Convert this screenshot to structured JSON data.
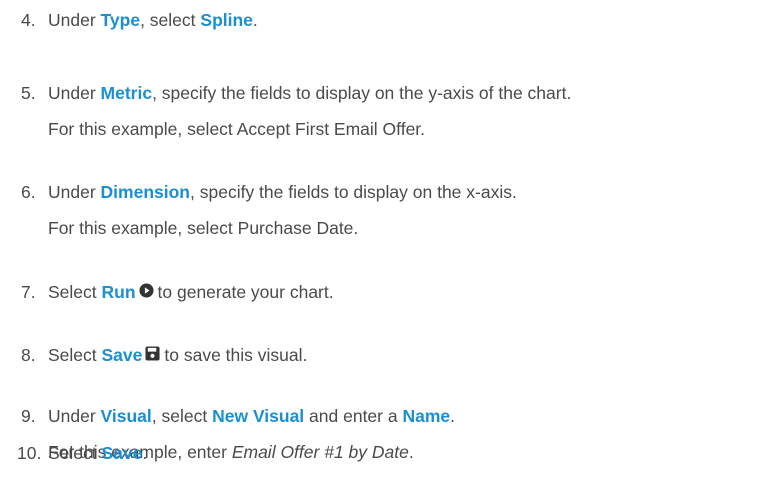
{
  "steps": [
    {
      "number": "4.",
      "segments": [
        {
          "text": "Under "
        },
        {
          "text": "Type",
          "kw": true
        },
        {
          "text": ", select "
        },
        {
          "text": "Spline",
          "kw": true
        },
        {
          "text": "."
        }
      ]
    },
    {
      "number": "5.",
      "segments": [
        {
          "text": "Under "
        },
        {
          "text": "Metric",
          "kw": true
        },
        {
          "text": ", specify the fields to display on the y-axis of the chart."
        }
      ],
      "line2": [
        {
          "text": "For this example, select Accept First Email Offer."
        }
      ]
    },
    {
      "number": "6.",
      "segments": [
        {
          "text": "Under "
        },
        {
          "text": "Dimension",
          "kw": true
        },
        {
          "text": ", specify the fields to display on the x-axis."
        }
      ],
      "line2": [
        {
          "text": "For this example, select Purchase Date."
        }
      ]
    },
    {
      "number": "7.",
      "segments": [
        {
          "text": "Select "
        },
        {
          "text": "Run",
          "kw": true
        },
        {
          "icon": "play-circle-icon"
        },
        {
          "text": "to generate your chart."
        }
      ]
    },
    {
      "number": "8.",
      "segments": [
        {
          "text": "Select "
        },
        {
          "text": "Save",
          "kw": true
        },
        {
          "icon": "floppy-disk-icon"
        },
        {
          "text": "to save this visual."
        }
      ]
    },
    {
      "number": "9.",
      "segments": [
        {
          "text": "Under "
        },
        {
          "text": "Visual",
          "kw": true
        },
        {
          "text": ", select "
        },
        {
          "text": "New Visual",
          "kw": true
        },
        {
          "text": " and enter a "
        },
        {
          "text": "Name",
          "kw": true
        },
        {
          "text": "."
        }
      ],
      "line2": [
        {
          "text": "For this example, enter "
        },
        {
          "text": "Email Offer #1 by Date",
          "em": true
        },
        {
          "text": "."
        }
      ]
    },
    {
      "number": "10.",
      "segments": [
        {
          "text": "Select "
        },
        {
          "text": "Save",
          "kw": true
        },
        {
          "text": "."
        }
      ]
    }
  ],
  "colors": {
    "keyword": "#1a8fd1",
    "body_text": "#4a4a4a",
    "icon": "#333333"
  }
}
